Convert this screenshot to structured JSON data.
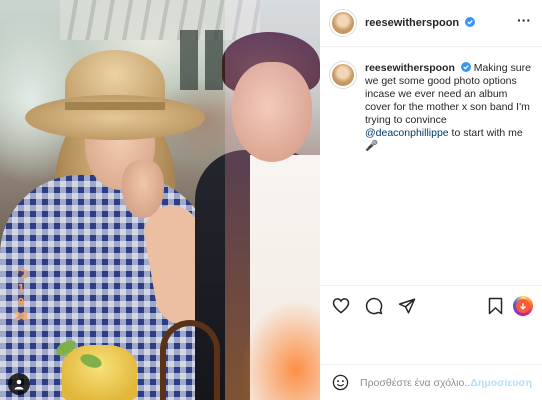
{
  "photo": {
    "date_stamp": "'21 9 28"
  },
  "post": {
    "username": "reesewitherspoon",
    "verified": true
  },
  "caption": {
    "username": "reesewitherspoon",
    "text_before_mention": "Making sure we get some good photo options incase we ever need an album cover for the mother x son band I'm trying to convince ",
    "mention": "@deaconphillippe",
    "text_after_mention": " to start with me 🎤"
  },
  "actions": {
    "icons": [
      "heart-icon",
      "comment-icon",
      "share-icon",
      "bookmark-icon",
      "promote-icon"
    ]
  },
  "comment_box": {
    "placeholder": "Προσθέστε ένα σχόλιο...",
    "post_label": "Δημοσίευση"
  },
  "colors": {
    "verified_blue": "#3897f0",
    "post_button": "#b2dffc",
    "mention": "#00376b"
  }
}
